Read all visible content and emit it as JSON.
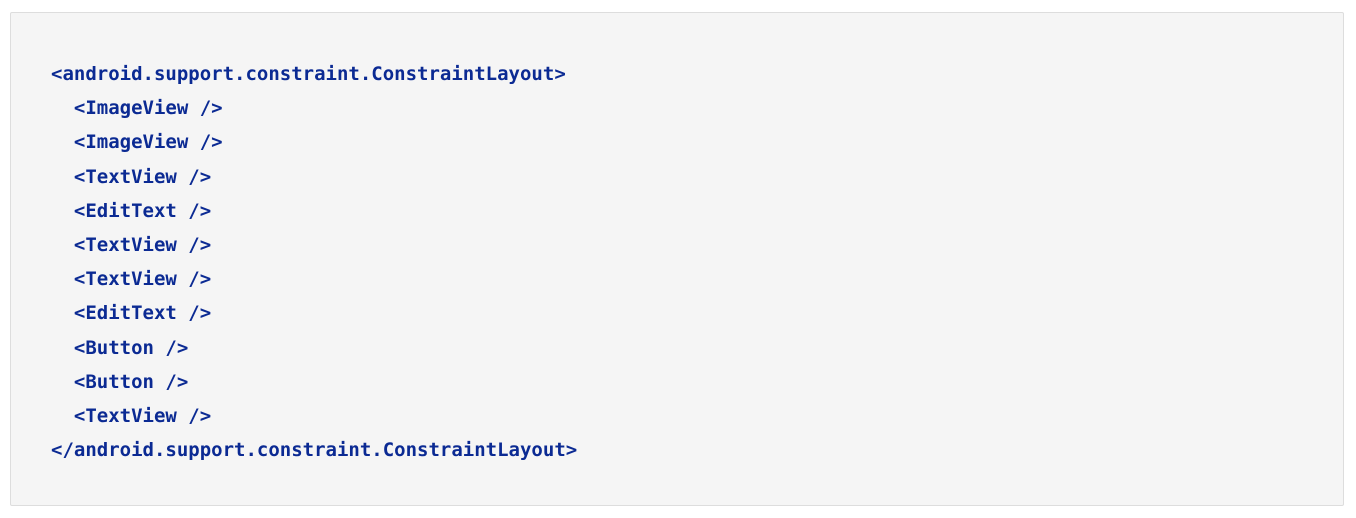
{
  "code_block": {
    "language": "xml",
    "text_color": "#0b2a93",
    "background_color": "#f5f5f5",
    "lines": [
      "<android.support.constraint.ConstraintLayout>",
      "  <ImageView />",
      "  <ImageView />",
      "  <TextView />",
      "  <EditText />",
      "  <TextView />",
      "  <TextView />",
      "  <EditText />",
      "  <Button />",
      "  <Button />",
      "  <TextView />",
      "</android.support.constraint.ConstraintLayout>"
    ]
  }
}
